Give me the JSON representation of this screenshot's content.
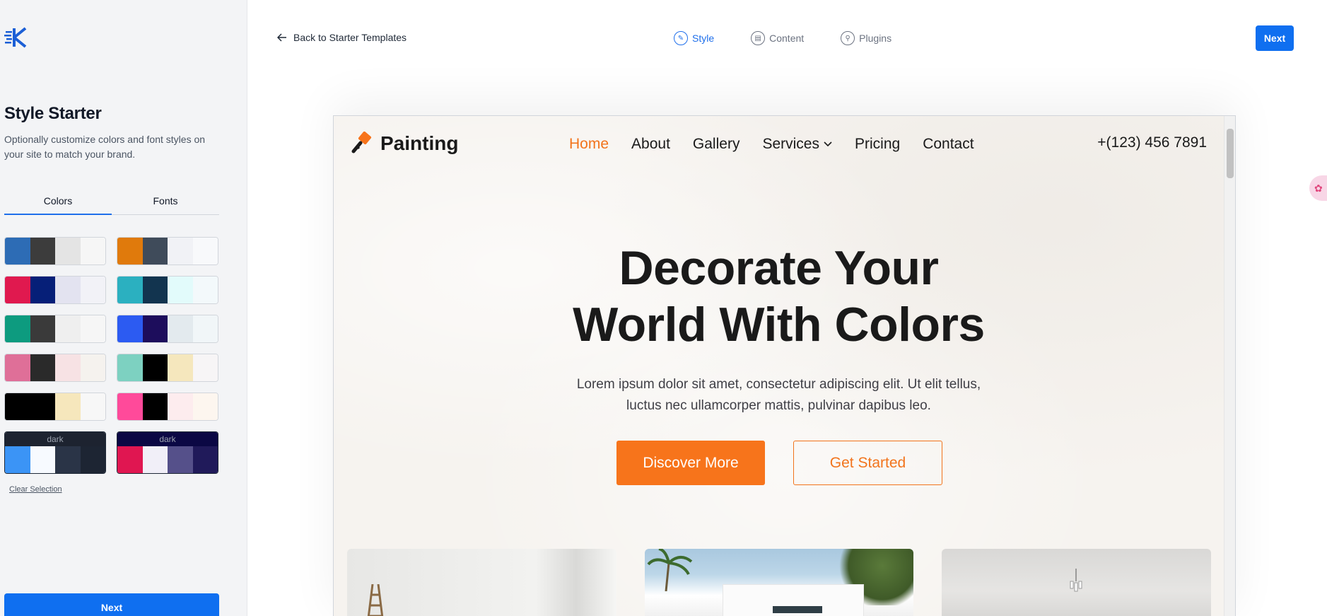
{
  "sidebar": {
    "title": "Style Starter",
    "description": "Optionally customize colors and font styles on your site to match your brand.",
    "tabs": [
      {
        "label": "Colors",
        "active": true
      },
      {
        "label": "Fonts",
        "active": false
      }
    ],
    "palettes": [
      {
        "colors": [
          "#2d6cb5",
          "#3c3c3c",
          "#e4e4e4",
          "#f6f6f6"
        ]
      },
      {
        "colors": [
          "#e07a0c",
          "#3f4b5a",
          "#f1f2f6",
          "#f8f9fb"
        ]
      },
      {
        "colors": [
          "#e0194f",
          "#061f78",
          "#e3e3f0",
          "#f2f2f7"
        ]
      },
      {
        "colors": [
          "#2bb0c0",
          "#12344f",
          "#e2fbfb",
          "#f3f9fb"
        ]
      },
      {
        "colors": [
          "#0d9b7f",
          "#3a3a3a",
          "#efefef",
          "#f6f6f6"
        ]
      },
      {
        "colors": [
          "#2c5bf2",
          "#1d0d5c",
          "#e3eaee",
          "#f1f6f8"
        ]
      },
      {
        "colors": [
          "#df6f98",
          "#2a2a2a",
          "#f7e2e4",
          "#f5f2ee"
        ]
      },
      {
        "colors": [
          "#7dd1c1",
          "#000000",
          "#f5e7bd",
          "#f7f5f6"
        ]
      },
      {
        "colors": [
          "#000000",
          "#000000",
          "#f6e7bc",
          "#f7f7f7"
        ]
      },
      {
        "colors": [
          "#ff4a9a",
          "#000000",
          "#fdecee",
          "#fdf6ef"
        ]
      }
    ],
    "dark_palettes": [
      {
        "label": "dark",
        "header": "#1d2330",
        "colors": [
          "#3b94f6",
          "#f7faff",
          "#2a3447",
          "#1d2533"
        ]
      },
      {
        "label": "dark",
        "header": "#0b0844",
        "colors": [
          "#e01651",
          "#f1eff8",
          "#55508a",
          "#201a5a"
        ]
      }
    ],
    "clear_selection": "Clear Selection",
    "next_label": "Next"
  },
  "topbar": {
    "back_label": "Back to Starter Templates",
    "steps": [
      {
        "label": "Style",
        "icon": "brush-icon",
        "active": true
      },
      {
        "label": "Content",
        "icon": "content-icon",
        "active": false
      },
      {
        "label": "Plugins",
        "icon": "plugin-icon",
        "active": false
      }
    ],
    "next_label": "Next"
  },
  "preview": {
    "brand": "Painting",
    "nav": [
      {
        "label": "Home",
        "active": true
      },
      {
        "label": "About",
        "active": false
      },
      {
        "label": "Gallery",
        "active": false
      },
      {
        "label": "Services",
        "active": false,
        "dropdown": true
      },
      {
        "label": "Pricing",
        "active": false
      },
      {
        "label": "Contact",
        "active": false
      }
    ],
    "phone": "+(123) 456 7891",
    "hero_title_line1": "Decorate Your",
    "hero_title_line2": "World With Colors",
    "hero_sub_line1": "Lorem ipsum dolor sit amet, consectetur adipiscing elit. Ut elit tellus,",
    "hero_sub_line2": "luctus nec ullamcorper mattis, pulvinar dapibus leo.",
    "primary_cta": "Discover More",
    "secondary_cta": "Get Started",
    "accent": "#f7741b"
  }
}
